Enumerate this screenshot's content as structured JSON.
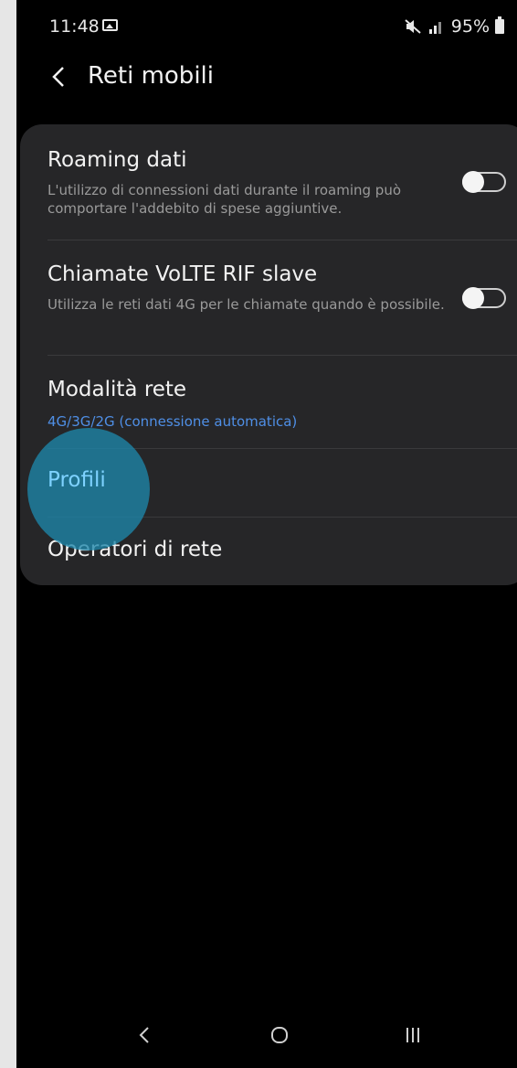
{
  "status_bar": {
    "time": "11:48",
    "battery": "95%",
    "icons": [
      "gallery-icon",
      "mute-icon",
      "signal-icon",
      "battery-icon"
    ]
  },
  "header": {
    "title": "Reti mobili",
    "back_icon": "chevron-left-icon"
  },
  "settings": [
    {
      "title": "Roaming dati",
      "subtitle": "L'utilizzo di connessioni dati durante il roaming può comportare l'addebito di spese aggiuntive.",
      "toggle": false
    },
    {
      "title": "Chiamate VoLTE RIF slave",
      "subtitle": "Utilizza le reti dati 4G per le chiamate quando è possibile.",
      "toggle": false
    },
    {
      "title": "Modalità rete",
      "subtitle": "4G/3G/2G (connessione automatica)"
    },
    {
      "title": "Profili"
    },
    {
      "title": "Operatori di rete"
    }
  ],
  "colors": {
    "background": "#000000",
    "card": "#262628",
    "accent_blue": "#4f8fe6",
    "touch_highlight": "#1e86aa"
  },
  "nav_bar": {
    "icons": [
      "back-nav-icon",
      "home-nav-icon",
      "recents-nav-icon"
    ]
  }
}
